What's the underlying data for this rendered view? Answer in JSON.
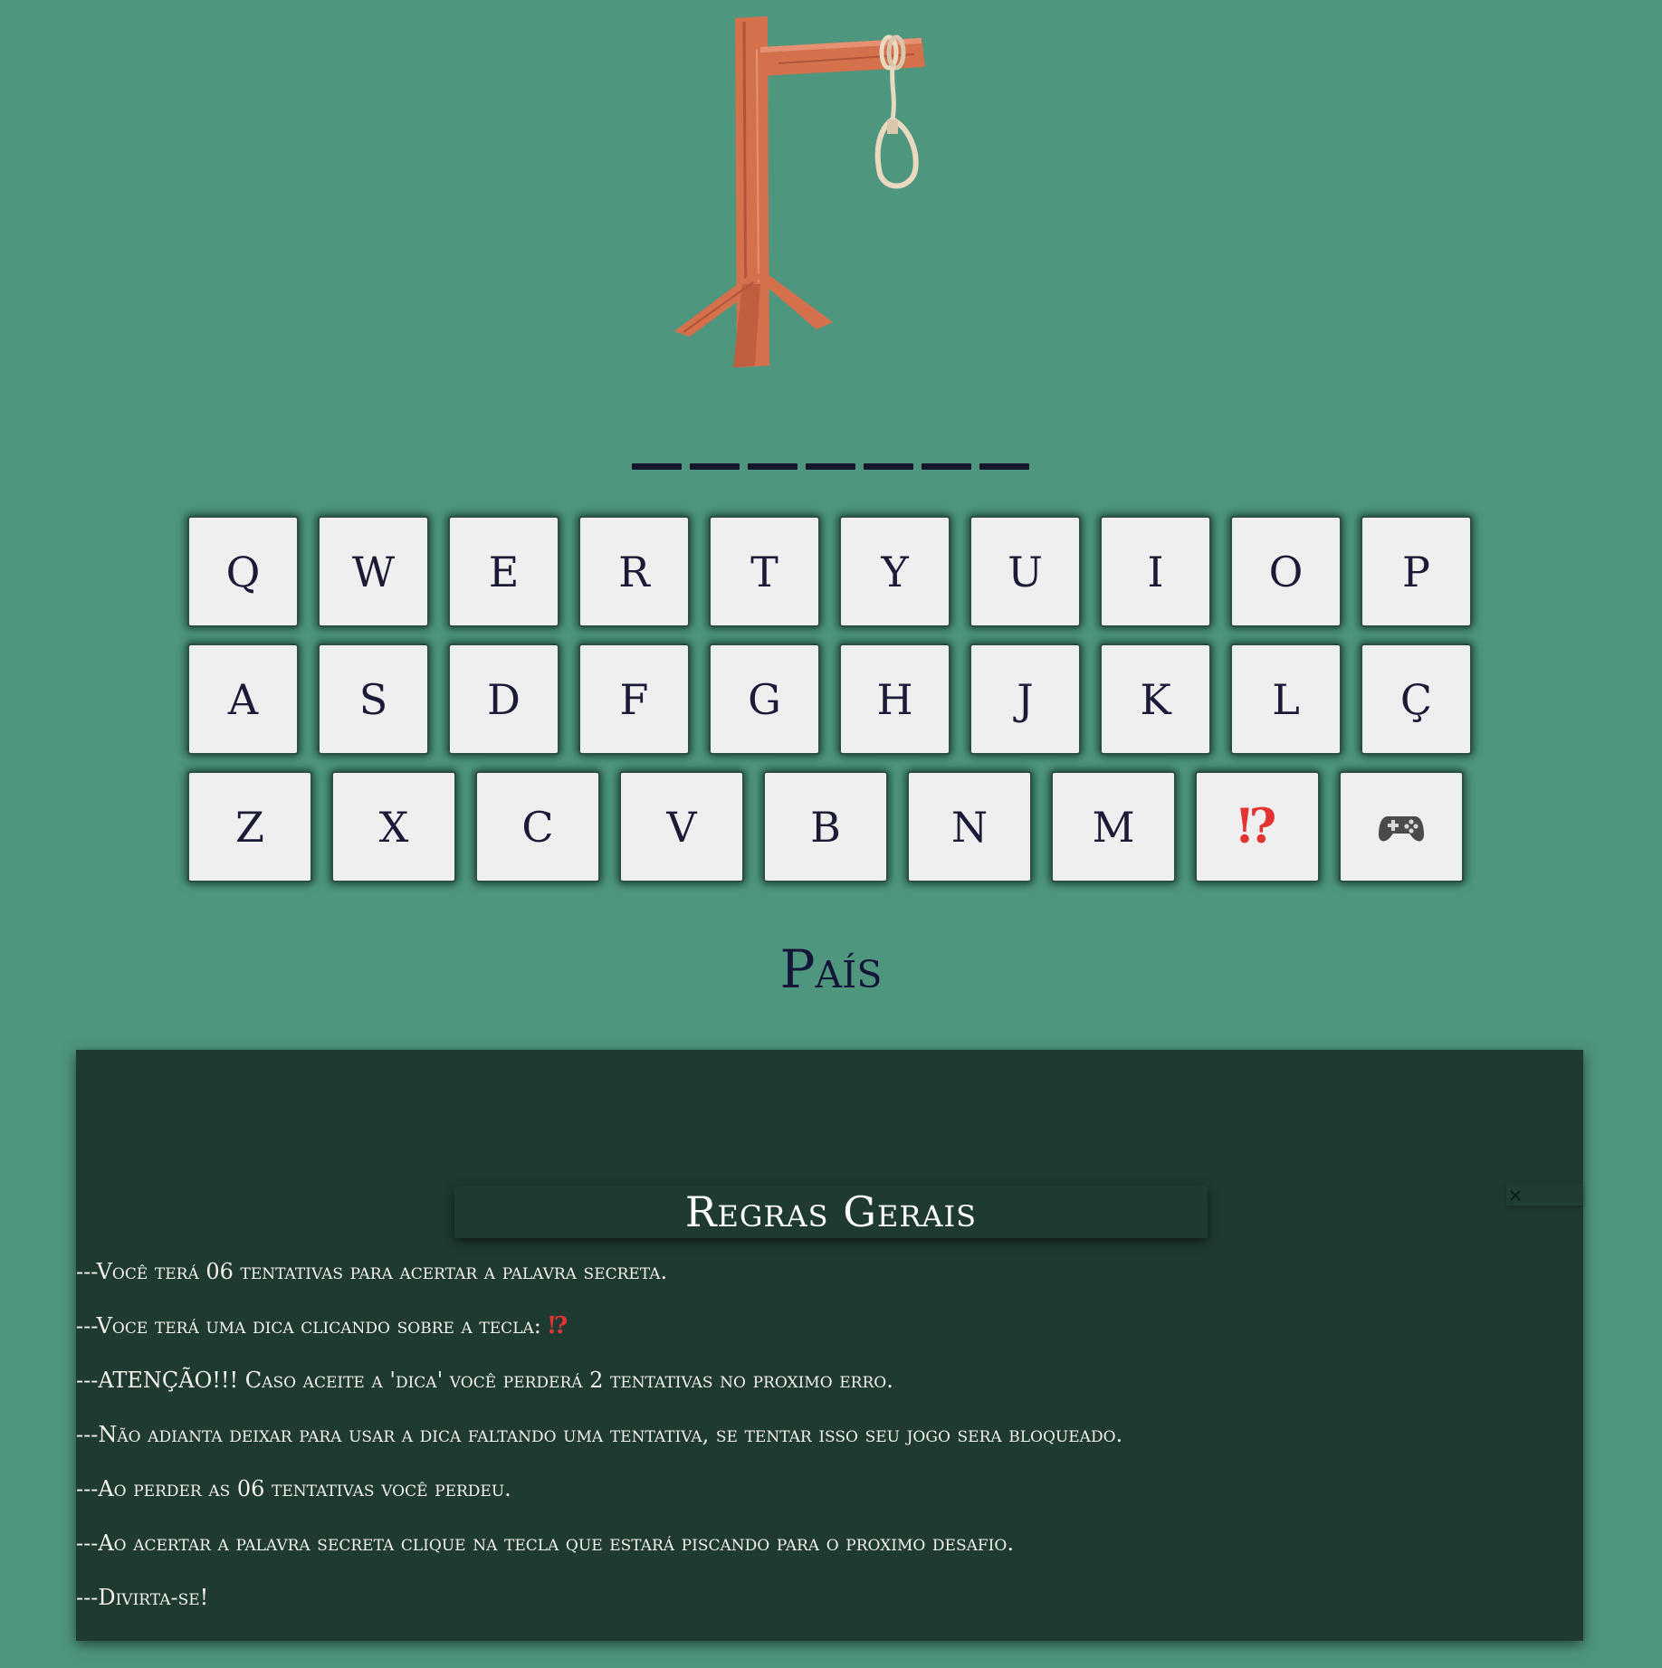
{
  "word": {
    "slot_count": 7
  },
  "keyboard": {
    "rows": [
      [
        "Q",
        "W",
        "E",
        "R",
        "T",
        "Y",
        "U",
        "I",
        "O",
        "P"
      ],
      [
        "A",
        "S",
        "D",
        "F",
        "G",
        "H",
        "J",
        "K",
        "L",
        "Ç"
      ],
      [
        "Z",
        "X",
        "C",
        "V",
        "B",
        "N",
        "M",
        "⁉",
        "🎮"
      ]
    ],
    "hint_key": "⁉",
    "game_key_icon": "gamepad-icon",
    "hint_color": "#e33333"
  },
  "category": "País",
  "rules": {
    "title": "Regras Gerais",
    "close_label": "×",
    "items": [
      "---Você terá 06 tentativas para acertar a palavra secreta.",
      "---Voce terá uma dica clicando sobre a tecla: ",
      "---ATENÇÃO!!! Caso aceite a 'dica' você perderá 2 tentativas no proximo erro.",
      "---Não adianta deixar para usar a dica faltando uma tentativa, se tentar isso seu jogo sera bloqueado.",
      "---Ao perder as 06 tentativas você perdeu.",
      "---Ao acertar a palavra secreta clique na tecla que estará piscando para o proximo desafio.",
      "---Divirta-se!"
    ],
    "item2_emoji": "⁉"
  },
  "colors": {
    "background": "#4f967e",
    "panel": "#1f3a31",
    "key_face": "#f0eff0",
    "wood": "#d4704c",
    "rope": "#e8d9c0"
  }
}
